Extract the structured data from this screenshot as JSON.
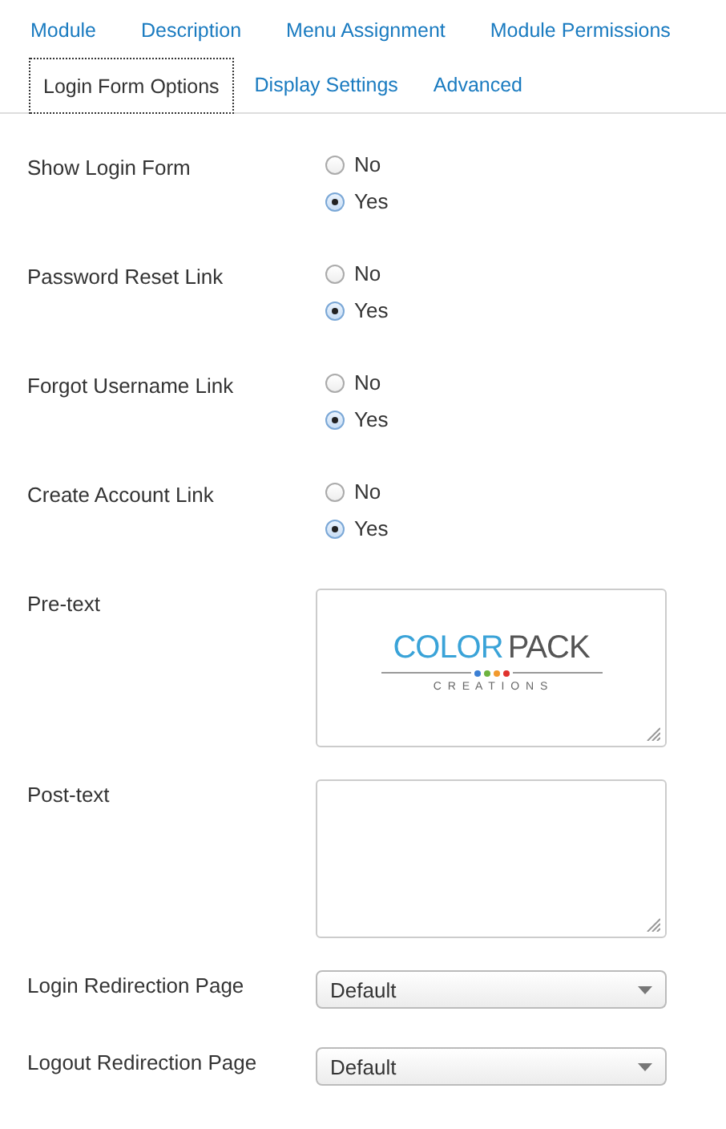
{
  "tab_rows": [
    [
      {
        "label": "Module",
        "selected": false
      },
      {
        "label": "Description",
        "selected": false
      },
      {
        "label": "Menu Assignment",
        "selected": false
      },
      {
        "label": "Module Permissions",
        "selected": false
      }
    ],
    [
      {
        "label": "Login Form Options",
        "selected": true
      },
      {
        "label": "Display Settings",
        "selected": false
      },
      {
        "label": "Advanced",
        "selected": false
      }
    ]
  ],
  "fields": [
    {
      "kind": "radio",
      "label": "Show Login Form",
      "options": [
        {
          "label": "No",
          "selected": false
        },
        {
          "label": "Yes",
          "selected": true
        }
      ]
    },
    {
      "kind": "radio",
      "label": "Password Reset Link",
      "options": [
        {
          "label": "No",
          "selected": false
        },
        {
          "label": "Yes",
          "selected": true
        }
      ]
    },
    {
      "kind": "radio",
      "label": "Forgot Username Link",
      "options": [
        {
          "label": "No",
          "selected": false
        },
        {
          "label": "Yes",
          "selected": true
        }
      ]
    },
    {
      "kind": "radio",
      "label": "Create Account Link",
      "options": [
        {
          "label": "No",
          "selected": false
        },
        {
          "label": "Yes",
          "selected": true
        }
      ]
    },
    {
      "kind": "textarea",
      "label": "Pre-text",
      "logo": {
        "word_1": "COLOR",
        "word_2": "PACK",
        "tagline": "C R E A T I O N S",
        "dots": [
          {
            "color": "#3b7fd4"
          },
          {
            "color": "#6db33f"
          },
          {
            "color": "#f29a2e"
          },
          {
            "color": "#e0322d"
          }
        ]
      }
    },
    {
      "kind": "textarea",
      "label": "Post-text"
    },
    {
      "kind": "select",
      "label": "Login Redirection Page",
      "value": "Default"
    },
    {
      "kind": "select",
      "label": "Logout Redirection Page",
      "value": "Default"
    }
  ]
}
